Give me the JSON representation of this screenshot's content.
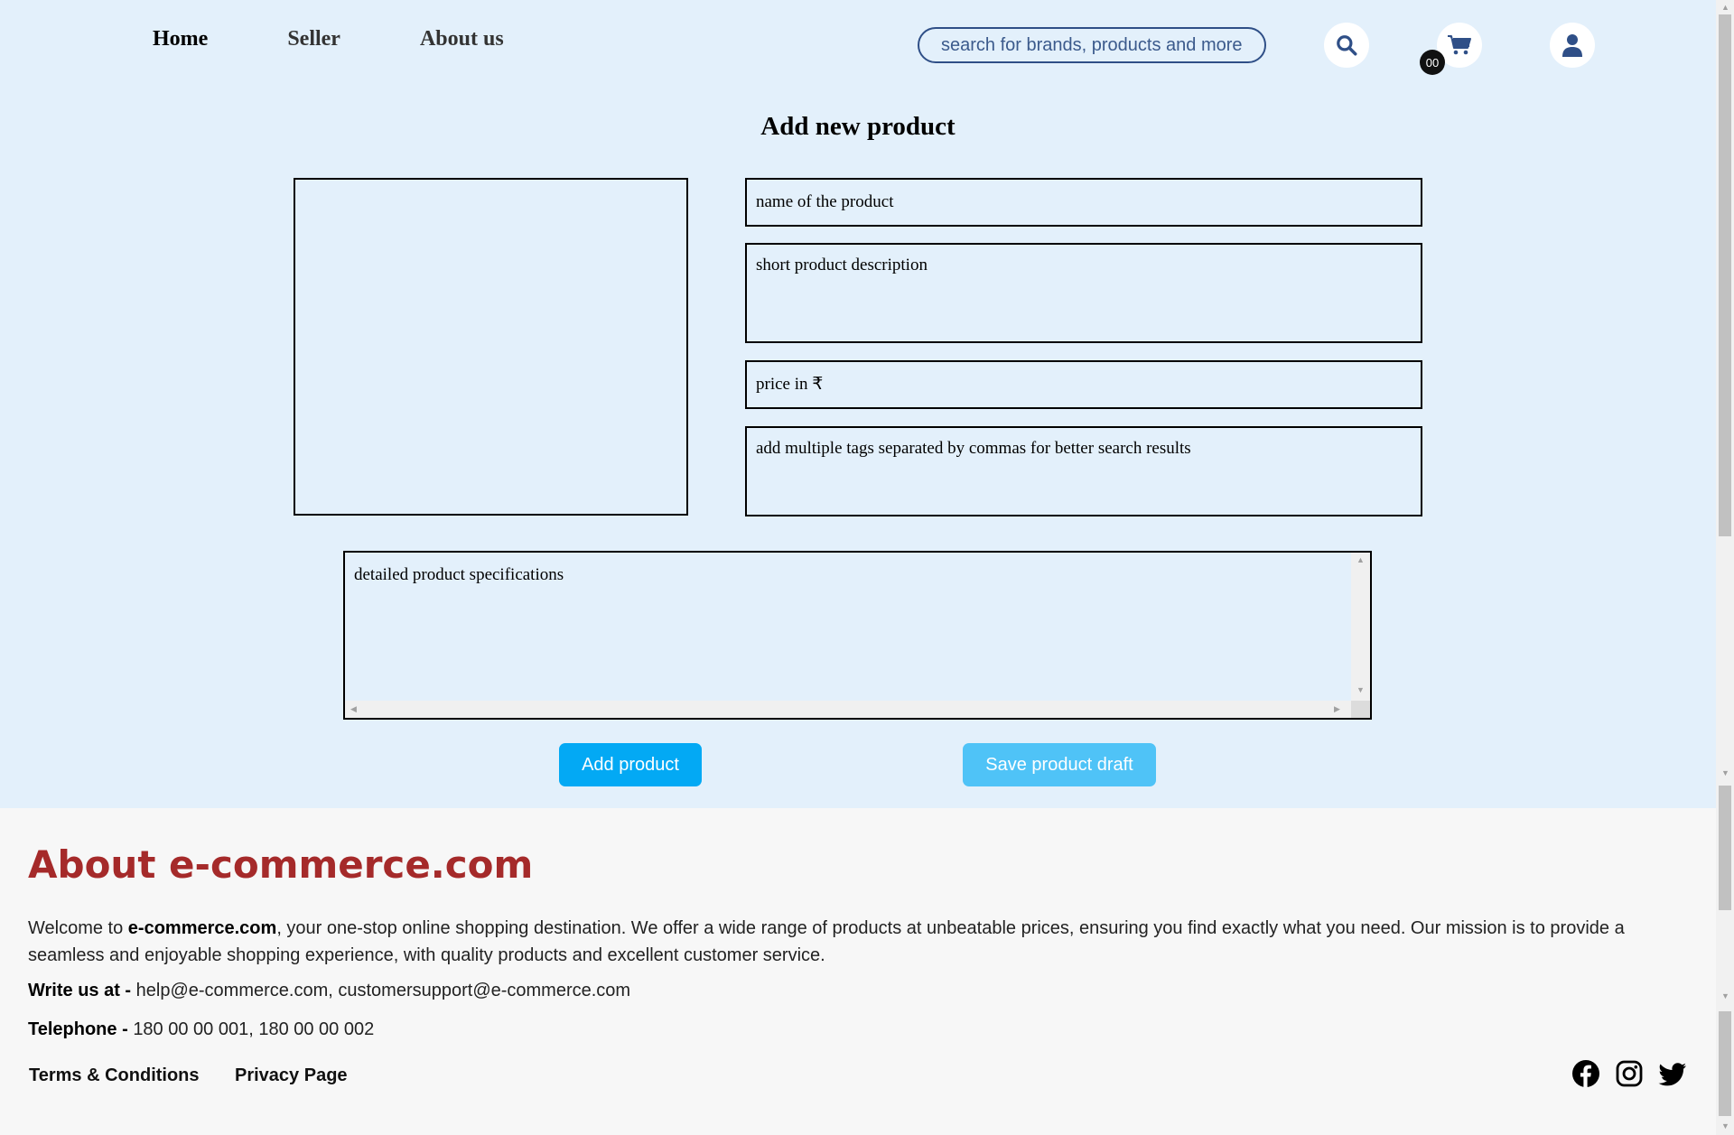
{
  "nav": {
    "home": "Home",
    "seller": "Seller",
    "about": "About us"
  },
  "search": {
    "placeholder": "search for brands, products and more"
  },
  "cart": {
    "count": "00"
  },
  "form": {
    "title": "Add new product",
    "name_placeholder": "name of the product",
    "short_desc_placeholder": "short product description",
    "price_placeholder": "price in ₹",
    "tags_placeholder": "add multiple tags separated by commas for better search results",
    "specs_placeholder": "detailed product specifications",
    "add_button": "Add product",
    "draft_button": "Save product draft"
  },
  "footer": {
    "title": "About e-commerce.com",
    "welcome_prefix": "Welcome to ",
    "brand": "e-commerce.com",
    "welcome_rest": ", your one-stop online shopping destination. We offer a wide range of products at unbeatable prices, ensuring you find exactly what you need. Our mission is to provide a seamless and enjoyable shopping experience, with quality products and excellent customer service.",
    "write_label": "Write us at - ",
    "emails": "help@e-commerce.com, customersupport@e-commerce.com",
    "phone_label": "Telephone - ",
    "phones": "180 00 00 001, 180 00 00 002",
    "terms": "Terms & Conditions",
    "privacy": "Privacy Page"
  },
  "icons": {
    "search": "search-icon",
    "cart": "cart-icon",
    "user": "user-icon",
    "facebook": "facebook-icon",
    "instagram": "instagram-icon",
    "twitter": "twitter-icon"
  },
  "colors": {
    "page_bg": "#e3f0fb",
    "footer_bg": "#f7f7f7",
    "primary_button": "#03a9f4",
    "secondary_button": "#4fc3f7",
    "footer_title": "#a52a2a",
    "icon_blue": "#2f4f87"
  }
}
